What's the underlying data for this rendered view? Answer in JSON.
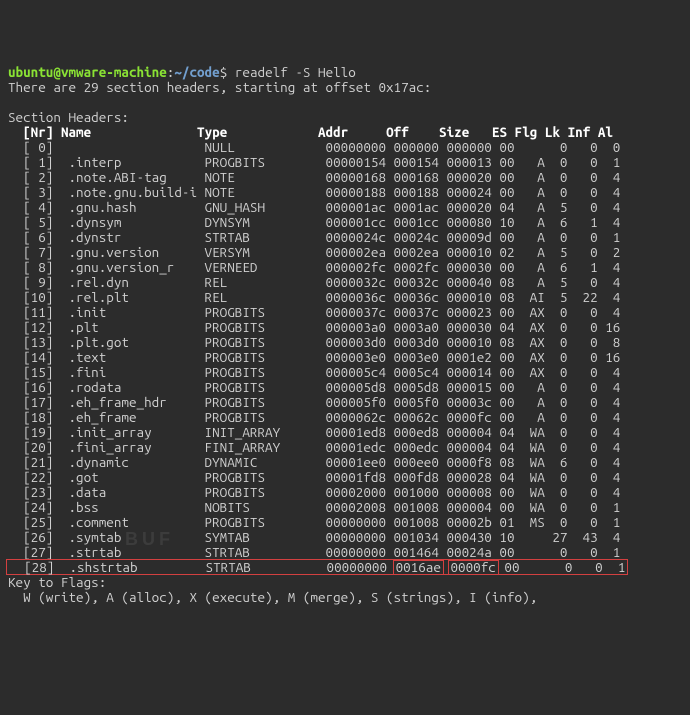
{
  "prompt": {
    "user": "ubuntu",
    "at": "@",
    "host": "vmware-machine",
    "colon": ":",
    "path": "~/code",
    "dollar": "$"
  },
  "command": "readelf -S Hello",
  "summary_line": "There are 29 section headers, starting at offset 0x17ac:",
  "section_title": "Section Headers:",
  "columns": {
    "nr": "[Nr]",
    "name": "Name",
    "type": "Type",
    "addr": "Addr",
    "off": "Off",
    "size": "Size",
    "es": "ES",
    "flg": "Flg",
    "lk": "Lk",
    "inf": "Inf",
    "al": "Al"
  },
  "rows": [
    {
      "nr": "[ 0]",
      "name": "",
      "type": "NULL",
      "addr": "00000000",
      "off": "000000",
      "size": "000000",
      "es": "00",
      "flg": "",
      "lk": "0",
      "inf": "0",
      "al": "0"
    },
    {
      "nr": "[ 1]",
      "name": ".interp",
      "type": "PROGBITS",
      "addr": "00000154",
      "off": "000154",
      "size": "000013",
      "es": "00",
      "flg": "A",
      "lk": "0",
      "inf": "0",
      "al": "1"
    },
    {
      "nr": "[ 2]",
      "name": ".note.ABI-tag",
      "type": "NOTE",
      "addr": "00000168",
      "off": "000168",
      "size": "000020",
      "es": "00",
      "flg": "A",
      "lk": "0",
      "inf": "0",
      "al": "4"
    },
    {
      "nr": "[ 3]",
      "name": ".note.gnu.build-i",
      "type": "NOTE",
      "addr": "00000188",
      "off": "000188",
      "size": "000024",
      "es": "00",
      "flg": "A",
      "lk": "0",
      "inf": "0",
      "al": "4"
    },
    {
      "nr": "[ 4]",
      "name": ".gnu.hash",
      "type": "GNU_HASH",
      "addr": "000001ac",
      "off": "0001ac",
      "size": "000020",
      "es": "04",
      "flg": "A",
      "lk": "5",
      "inf": "0",
      "al": "4"
    },
    {
      "nr": "[ 5]",
      "name": ".dynsym",
      "type": "DYNSYM",
      "addr": "000001cc",
      "off": "0001cc",
      "size": "000080",
      "es": "10",
      "flg": "A",
      "lk": "6",
      "inf": "1",
      "al": "4"
    },
    {
      "nr": "[ 6]",
      "name": ".dynstr",
      "type": "STRTAB",
      "addr": "0000024c",
      "off": "00024c",
      "size": "00009d",
      "es": "00",
      "flg": "A",
      "lk": "0",
      "inf": "0",
      "al": "1"
    },
    {
      "nr": "[ 7]",
      "name": ".gnu.version",
      "type": "VERSYM",
      "addr": "000002ea",
      "off": "0002ea",
      "size": "000010",
      "es": "02",
      "flg": "A",
      "lk": "5",
      "inf": "0",
      "al": "2"
    },
    {
      "nr": "[ 8]",
      "name": ".gnu.version_r",
      "type": "VERNEED",
      "addr": "000002fc",
      "off": "0002fc",
      "size": "000030",
      "es": "00",
      "flg": "A",
      "lk": "6",
      "inf": "1",
      "al": "4"
    },
    {
      "nr": "[ 9]",
      "name": ".rel.dyn",
      "type": "REL",
      "addr": "0000032c",
      "off": "00032c",
      "size": "000040",
      "es": "08",
      "flg": "A",
      "lk": "5",
      "inf": "0",
      "al": "4"
    },
    {
      "nr": "[10]",
      "name": ".rel.plt",
      "type": "REL",
      "addr": "0000036c",
      "off": "00036c",
      "size": "000010",
      "es": "08",
      "flg": "AI",
      "lk": "5",
      "inf": "22",
      "al": "4"
    },
    {
      "nr": "[11]",
      "name": ".init",
      "type": "PROGBITS",
      "addr": "0000037c",
      "off": "00037c",
      "size": "000023",
      "es": "00",
      "flg": "AX",
      "lk": "0",
      "inf": "0",
      "al": "4"
    },
    {
      "nr": "[12]",
      "name": ".plt",
      "type": "PROGBITS",
      "addr": "000003a0",
      "off": "0003a0",
      "size": "000030",
      "es": "04",
      "flg": "AX",
      "lk": "0",
      "inf": "0",
      "al": "16"
    },
    {
      "nr": "[13]",
      "name": ".plt.got",
      "type": "PROGBITS",
      "addr": "000003d0",
      "off": "0003d0",
      "size": "000010",
      "es": "08",
      "flg": "AX",
      "lk": "0",
      "inf": "0",
      "al": "8"
    },
    {
      "nr": "[14]",
      "name": ".text",
      "type": "PROGBITS",
      "addr": "000003e0",
      "off": "0003e0",
      "size": "0001e2",
      "es": "00",
      "flg": "AX",
      "lk": "0",
      "inf": "0",
      "al": "16"
    },
    {
      "nr": "[15]",
      "name": ".fini",
      "type": "PROGBITS",
      "addr": "000005c4",
      "off": "0005c4",
      "size": "000014",
      "es": "00",
      "flg": "AX",
      "lk": "0",
      "inf": "0",
      "al": "4"
    },
    {
      "nr": "[16]",
      "name": ".rodata",
      "type": "PROGBITS",
      "addr": "000005d8",
      "off": "0005d8",
      "size": "000015",
      "es": "00",
      "flg": "A",
      "lk": "0",
      "inf": "0",
      "al": "4"
    },
    {
      "nr": "[17]",
      "name": ".eh_frame_hdr",
      "type": "PROGBITS",
      "addr": "000005f0",
      "off": "0005f0",
      "size": "00003c",
      "es": "00",
      "flg": "A",
      "lk": "0",
      "inf": "0",
      "al": "4"
    },
    {
      "nr": "[18]",
      "name": ".eh_frame",
      "type": "PROGBITS",
      "addr": "0000062c",
      "off": "00062c",
      "size": "0000fc",
      "es": "00",
      "flg": "A",
      "lk": "0",
      "inf": "0",
      "al": "4"
    },
    {
      "nr": "[19]",
      "name": ".init_array",
      "type": "INIT_ARRAY",
      "addr": "00001ed8",
      "off": "000ed8",
      "size": "000004",
      "es": "04",
      "flg": "WA",
      "lk": "0",
      "inf": "0",
      "al": "4"
    },
    {
      "nr": "[20]",
      "name": ".fini_array",
      "type": "FINI_ARRAY",
      "addr": "00001edc",
      "off": "000edc",
      "size": "000004",
      "es": "04",
      "flg": "WA",
      "lk": "0",
      "inf": "0",
      "al": "4"
    },
    {
      "nr": "[21]",
      "name": ".dynamic",
      "type": "DYNAMIC",
      "addr": "00001ee0",
      "off": "000ee0",
      "size": "0000f8",
      "es": "08",
      "flg": "WA",
      "lk": "6",
      "inf": "0",
      "al": "4"
    },
    {
      "nr": "[22]",
      "name": ".got",
      "type": "PROGBITS",
      "addr": "00001fd8",
      "off": "000fd8",
      "size": "000028",
      "es": "04",
      "flg": "WA",
      "lk": "0",
      "inf": "0",
      "al": "4"
    },
    {
      "nr": "[23]",
      "name": ".data",
      "type": "PROGBITS",
      "addr": "00002000",
      "off": "001000",
      "size": "000008",
      "es": "00",
      "flg": "WA",
      "lk": "0",
      "inf": "0",
      "al": "4"
    },
    {
      "nr": "[24]",
      "name": ".bss",
      "type": "NOBITS",
      "addr": "00002008",
      "off": "001008",
      "size": "000004",
      "es": "00",
      "flg": "WA",
      "lk": "0",
      "inf": "0",
      "al": "1"
    },
    {
      "nr": "[25]",
      "name": ".comment",
      "type": "PROGBITS",
      "addr": "00000000",
      "off": "001008",
      "size": "00002b",
      "es": "01",
      "flg": "MS",
      "lk": "0",
      "inf": "0",
      "al": "1"
    },
    {
      "nr": "[26]",
      "name": ".symtab",
      "type": "SYMTAB",
      "addr": "00000000",
      "off": "001034",
      "size": "000430",
      "es": "10",
      "flg": "",
      "lk": "27",
      "inf": "43",
      "al": "4"
    },
    {
      "nr": "[27]",
      "name": ".strtab",
      "type": "STRTAB",
      "addr": "00000000",
      "off": "001464",
      "size": "00024a",
      "es": "00",
      "flg": "",
      "lk": "0",
      "inf": "0",
      "al": "1"
    },
    {
      "nr": "[28]",
      "name": ".shstrtab",
      "type": "STRTAB",
      "addr": "00000000",
      "off": "0016ae",
      "size": "0000fc",
      "es": "00",
      "flg": "",
      "lk": "0",
      "inf": "0",
      "al": "1"
    }
  ],
  "key_title": "Key to Flags:",
  "key_line": "  W (write), A (alloc), X (execute), M (merge), S (strings), I (info),",
  "watermark": "BUF"
}
